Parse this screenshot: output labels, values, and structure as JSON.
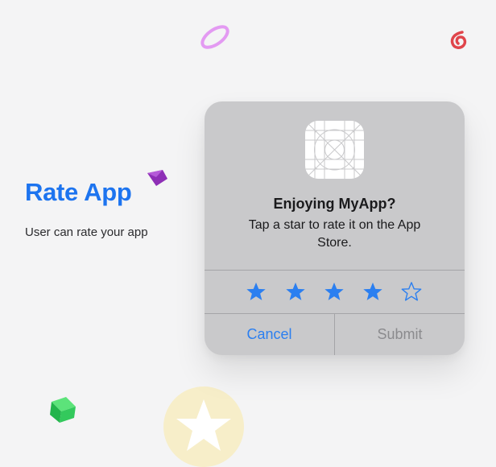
{
  "hero": {
    "title": "Rate App",
    "subtitle": "User can rate your app"
  },
  "dialog": {
    "app_icon": "app-icon-placeholder",
    "title": "Enjoying MyApp?",
    "message": "Tap a star to rate it on the App Store.",
    "rating": {
      "selected": 4,
      "max": 5
    },
    "cancel_label": "Cancel",
    "submit_label": "Submit"
  },
  "colors": {
    "accent": "#1d74ef",
    "star": "#2b7ff0",
    "dialog_bg": "#c9c9cb",
    "disabled_text": "#8b8b8e",
    "page_bg": "#f4f4f5"
  },
  "decorations": [
    "ring-shape",
    "spiral-shape",
    "gem-shape",
    "cube-shape",
    "star-badge-shape"
  ]
}
